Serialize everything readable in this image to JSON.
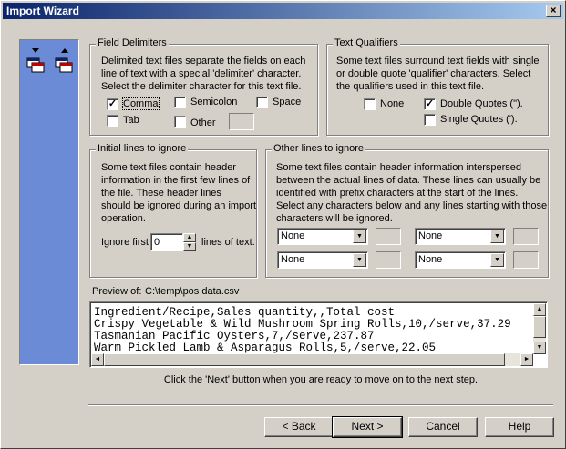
{
  "window": {
    "title": "Import Wizard",
    "close_glyph": "×"
  },
  "field_delimiters": {
    "title": "Field Delimiters",
    "text": [
      "Delimited text files separate the fields on each",
      "line of text with a special 'delimiter' character.",
      "Select the delimiter character for this text file."
    ],
    "comma": {
      "label": "Comma",
      "checked": true
    },
    "semicolon": {
      "label": "Semicolon",
      "checked": false
    },
    "space": {
      "label": "Space",
      "checked": false
    },
    "tab": {
      "label": "Tab",
      "checked": false
    },
    "other": {
      "label": "Other",
      "checked": false,
      "value": ""
    }
  },
  "text_qualifiers": {
    "title": "Text Qualifiers",
    "text": [
      "Some text files surround text fields with single",
      "or double quote 'qualifier' characters.  Select",
      "the qualifiers used in this text file."
    ],
    "none": {
      "label": "None",
      "checked": false
    },
    "double_quotes": {
      "label": "Double Quotes (\").",
      "checked": true
    },
    "single_quotes": {
      "label": "Single Quotes (').",
      "checked": false
    }
  },
  "initial_lines": {
    "title": "Initial lines to ignore",
    "text": [
      "Some text files contain header",
      "information in the first few lines of",
      "the file.  These header lines",
      "should be ignored during an import",
      "operation."
    ],
    "ignore_first_label": "Ignore first",
    "ignore_first_value": "0",
    "lines_of_text_label": "lines of text."
  },
  "other_lines": {
    "title": "Other lines to ignore",
    "text": [
      "Some text files contain header information interspersed",
      "between the actual lines of data. These lines can usually be",
      "identified with prefix characters at the start of the lines.",
      "Select any characters below and any lines starting with those",
      "characters will be ignored."
    ],
    "combo1": "None",
    "combo2": "None",
    "combo3": "None",
    "combo4": "None"
  },
  "preview": {
    "label": "Preview of:",
    "path": "C:\\temp\\pos data.csv",
    "lines": [
      "Ingredient/Recipe,Sales quantity,,Total cost",
      "Crispy Vegetable & Wild Mushroom Spring Rolls,10,/serve,37.29",
      "Tasmanian Pacific Oysters,7,/serve,237.87",
      "Warm Pickled Lamb & Asparagus Rolls,5,/serve,22.05"
    ]
  },
  "hint": "Click the 'Next' button when you are ready to move on to the next step.",
  "buttons": {
    "back": "< Back",
    "next": "Next >",
    "cancel": "Cancel",
    "help": "Help"
  },
  "icons": {
    "step_icon": "windows-transfer-icon",
    "check_glyph": "✓",
    "up_arrow": "▲",
    "down_arrow": "▼",
    "left_arrow": "◄",
    "right_arrow": "►"
  },
  "colors": {
    "title_start": "#0a246a",
    "title_end": "#a6caf0",
    "side_panel": "#6b8bd6",
    "face": "#d4d0c8"
  }
}
